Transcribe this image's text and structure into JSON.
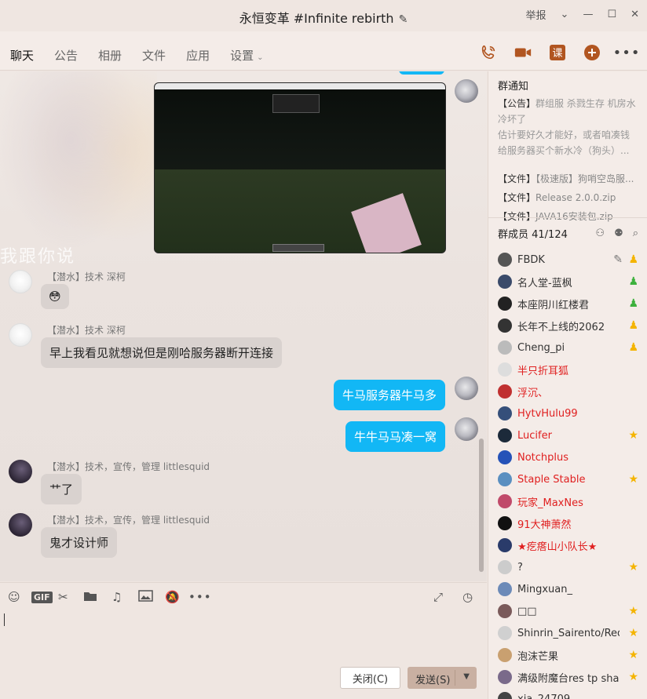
{
  "window": {
    "title": "永恒变革 #Infinite rebirth",
    "report": "举报"
  },
  "tabs": [
    {
      "label": "聊天",
      "active": true
    },
    {
      "label": "公告"
    },
    {
      "label": "相册"
    },
    {
      "label": "文件"
    },
    {
      "label": "应用"
    },
    {
      "label": "设置"
    }
  ],
  "chat": {
    "bg_text": "我跟你说",
    "messages": [
      {
        "nick": "【潜水】技术 深柯",
        "text": "😳",
        "side": "left"
      },
      {
        "nick": "【潜水】技术 深柯",
        "text": "早上我看见就想说但是刚哈服务器断开连接",
        "side": "left"
      },
      {
        "text": "牛马服务器牛马多",
        "side": "right"
      },
      {
        "text": "牛牛马马凑一窝",
        "side": "right"
      },
      {
        "nick": "【潜水】技术，宣传，管理 littlesquid",
        "text": "艹了",
        "side": "left"
      },
      {
        "nick": "【潜水】技术，宣传，管理 littlesquid",
        "text": "鬼才设计师",
        "side": "left"
      }
    ]
  },
  "sidebar": {
    "notice_title": "群通知",
    "notice_tag": "【公告】",
    "notice_text1": "群组服 杀戮生存 机房水冷坏了",
    "notice_text2": "估计要好久才能好，或者咱凑钱给服务器买个新水冷（狗头）...",
    "files": [
      {
        "tag": "【文件】",
        "name": "【极速版】狗哨空岛服..."
      },
      {
        "tag": "【文件】",
        "name": "Release 2.0.0.zip"
      },
      {
        "tag": "【文件】",
        "name": "JAVA16安装包.zip"
      }
    ],
    "members_label": "群成员 41/124",
    "members": [
      {
        "name": "FBDK",
        "badge": "owner"
      },
      {
        "name": "名人堂-蓝枫",
        "badge": "admin"
      },
      {
        "name": "本座阴川红楼君",
        "badge": "admin"
      },
      {
        "name": "长年不上线的2062",
        "badge": "owner"
      },
      {
        "name": "Cheng_pi",
        "badge": "owner"
      },
      {
        "name": "半只折耳狐",
        "red": true
      },
      {
        "name": "浮沉、",
        "red": true
      },
      {
        "name": "HytvHulu99",
        "red": true
      },
      {
        "name": "Lucifer",
        "red": true,
        "badge": "star"
      },
      {
        "name": "Notchplus",
        "red": true
      },
      {
        "name": "Staple Stable",
        "red": true,
        "badge": "star"
      },
      {
        "name": "玩家_MaxNes",
        "red": true
      },
      {
        "name": "91大神萧然",
        "red": true
      },
      {
        "name": "★疙瘩山小队长★",
        "red": true
      },
      {
        "name": "?",
        "badge": "star"
      },
      {
        "name": "Mingxuan_"
      },
      {
        "name": "□□",
        "badge": "star"
      },
      {
        "name": "Shinrin_Sairento/Reda",
        "badge": "star"
      },
      {
        "name": "泡沫芒果",
        "badge": "star"
      },
      {
        "name": "满级附魔台res tp shang",
        "badge": "star"
      },
      {
        "name": "xia_24709"
      }
    ]
  },
  "input": {
    "close_label": "关闭(C)",
    "send_label": "发送(S)"
  },
  "colors": {
    "bubble_me": "#12b7f5",
    "accent": "#b15520",
    "red_name": "#e02020"
  }
}
